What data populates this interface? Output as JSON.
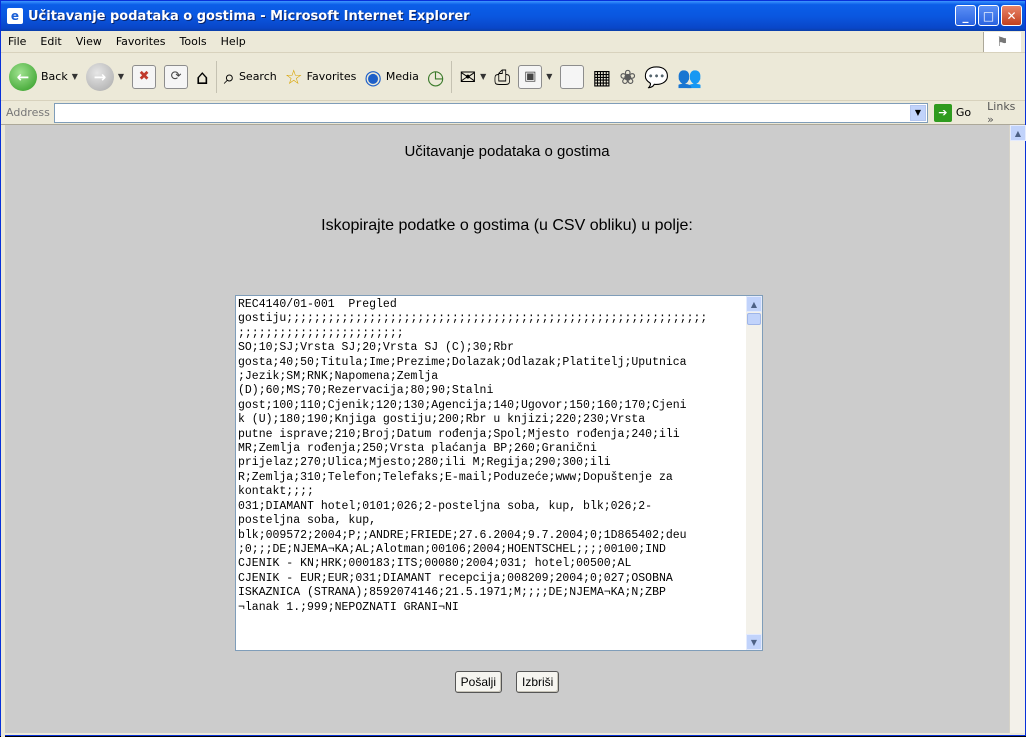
{
  "window": {
    "title": "Učitavanje podataka o gostima - Microsoft Internet Explorer"
  },
  "menu": [
    "File",
    "Edit",
    "View",
    "Favorites",
    "Tools",
    "Help"
  ],
  "toolbar": {
    "back_label": "Back",
    "search_label": "Search",
    "favorites_label": "Favorites",
    "media_label": "Media"
  },
  "address": {
    "label": "Address",
    "value": "",
    "go_label": "Go",
    "links_label": "Links »"
  },
  "page": {
    "title": "Učitavanje podataka o gostima",
    "instruction": "Iskopirajte podatke o gostima (u CSV obliku) u polje:",
    "csv_lines": [
      "REC4140/01-001  Pregled",
      "gostiju;;;;;;;;;;;;;;;;;;;;;;;;;;;;;;;;;;;;;;;;;;;;;;;;;;;;;;;;;;;;;",
      ";;;;;;;;;;;;;;;;;;;;;;;;",
      "SO;10;SJ;Vrsta SJ;20;Vrsta SJ (C);30;Rbr",
      "gosta;40;50;Titula;Ime;Prezime;Dolazak;Odlazak;Platitelj;Uputnica",
      ";Jezik;SM;RNK;Napomena;Zemlja",
      "(D);60;MS;70;Rezervacija;80;90;Stalni",
      "gost;100;110;Cjenik;120;130;Agencija;140;Ugovor;150;160;170;Cjeni",
      "k (U);180;190;Knjiga gostiju;200;Rbr u knjizi;220;230;Vrsta",
      "putne isprave;210;Broj;Datum rođenja;Spol;Mjesto rođenja;240;ili",
      "MR;Zemlja rođenja;250;Vrsta plaćanja BP;260;Granični",
      "prijelaz;270;Ulica;Mjesto;280;ili M;Regija;290;300;ili",
      "R;Zemlja;310;Telefon;Telefaks;E-mail;Poduzeće;www;Dopuštenje za",
      "kontakt;;;;",
      "031;DIAMANT hotel;0101;026;2-posteljna soba, kup, blk;026;2-",
      "posteljna soba, kup,",
      "blk;009572;2004;P;;ANDRE;FRIEDE;27.6.2004;9.7.2004;0;1D865402;deu",
      ";0;;;DE;NJEMA¬KA;AL;Alotman;00106;2004;HOENTSCHEL;;;;00100;IND",
      "CJENIK - KN;HRK;000183;ITS;00080;2004;031; hotel;00500;AL",
      "CJENIK - EUR;EUR;031;DIAMANT recepcija;008209;2004;0;027;OSOBNA",
      "ISKAZNICA (STRANA);8592074146;21.5.1971;M;;;;DE;NJEMA¬KA;N;ZBP",
      "¬lanak 1.;999;NEPOZNATI GRANI¬NI"
    ],
    "send_label": "Pošalji",
    "delete_label": "Izbriši"
  }
}
